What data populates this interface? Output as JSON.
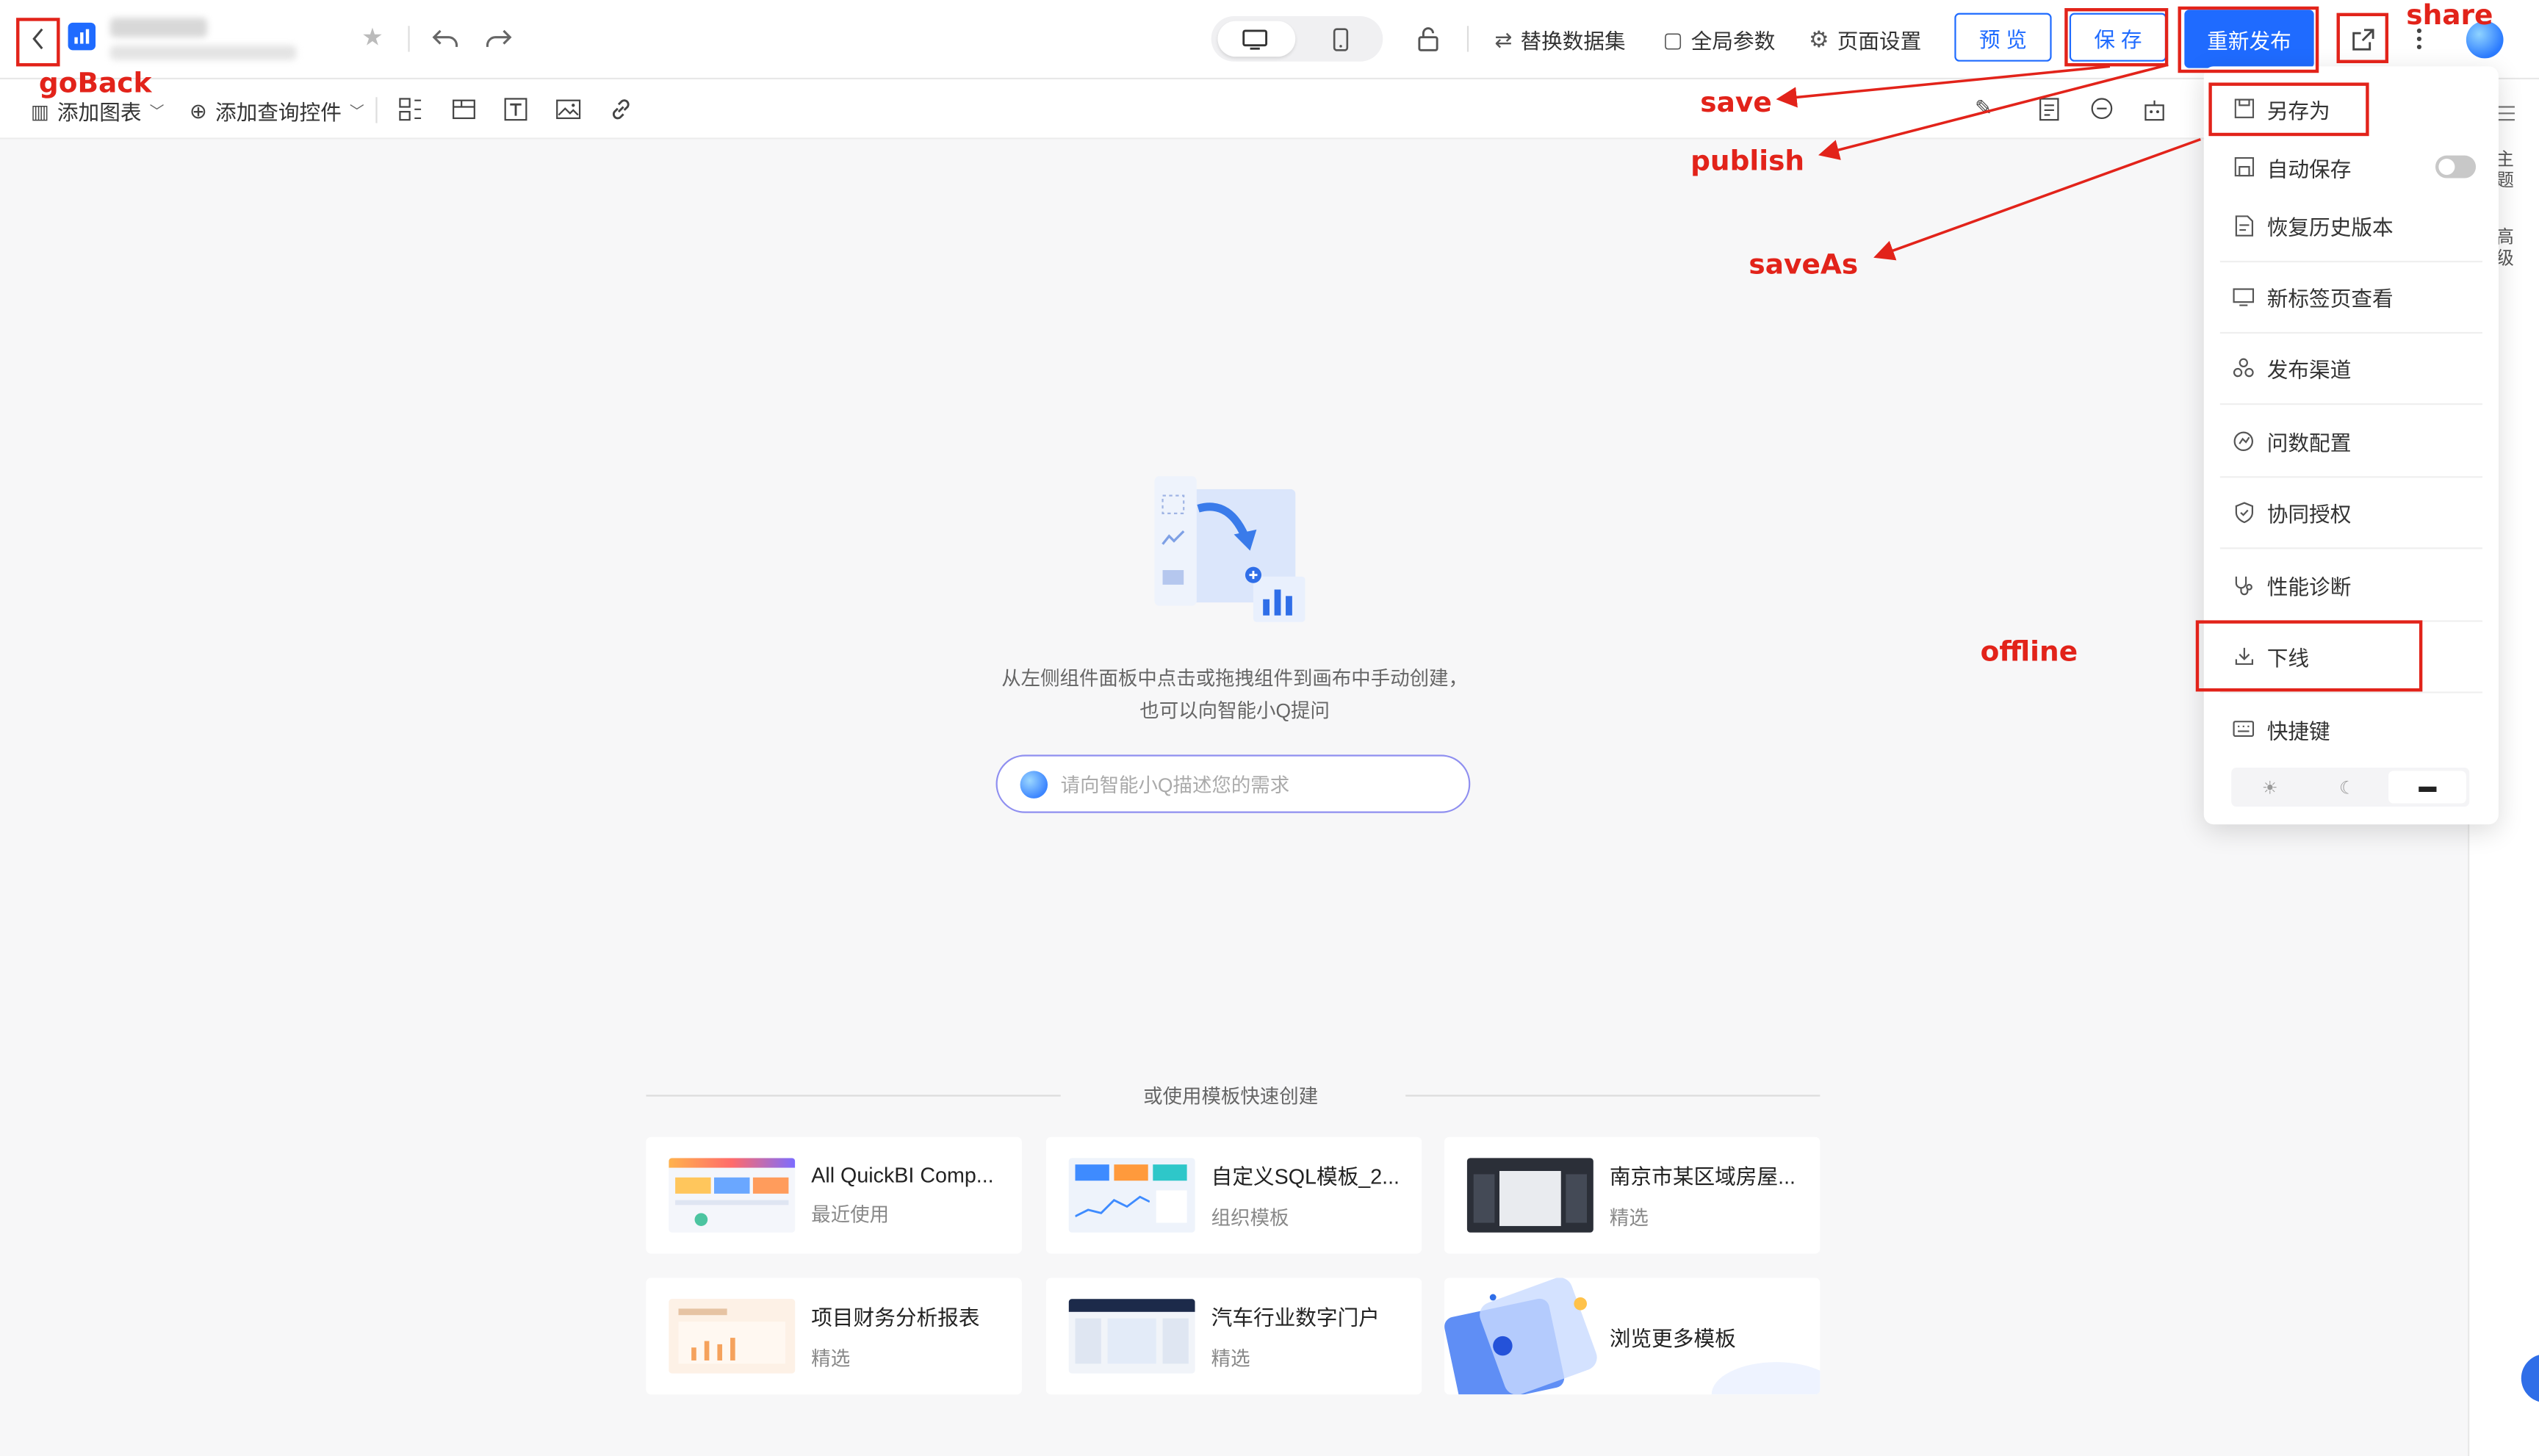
{
  "header": {
    "toolbar_labels": {
      "replace_dataset": "替换数据集",
      "global_params": "全局参数",
      "page_settings": "页面设置"
    },
    "buttons": {
      "preview": "预 览",
      "save": "保 存",
      "republish": "重新发布"
    }
  },
  "toolbar2": {
    "add_chart": "添加图表",
    "add_query_control": "添加查询控件"
  },
  "canvas": {
    "empty_line1": "从左侧组件面板中点击或拖拽组件到画布中手动创建，",
    "empty_line2": "也可以向智能小Q提问",
    "q_placeholder": "请向智能小Q描述您的需求",
    "template_heading": "或使用模板快速创建",
    "templates": [
      {
        "name": "All QuickBI Comp...",
        "sub": "最近使用"
      },
      {
        "name": "自定义SQL模板_2...",
        "sub": "组织模板"
      },
      {
        "name": "南京市某区域房屋...",
        "sub": "精选"
      },
      {
        "name": "项目财务分析报表",
        "sub": "精选"
      },
      {
        "name": "汽车行业数字门户",
        "sub": "精选"
      },
      {
        "name": "浏览更多模板",
        "sub": ""
      }
    ]
  },
  "menu": {
    "items": [
      {
        "label": "另存为"
      },
      {
        "label": "自动保存"
      },
      {
        "label": "恢复历史版本"
      },
      {
        "label": "新标签页查看"
      },
      {
        "label": "发布渠道"
      },
      {
        "label": "问数配置"
      },
      {
        "label": "协同授权"
      },
      {
        "label": "性能诊断"
      },
      {
        "label": "下线"
      },
      {
        "label": "快捷键"
      }
    ]
  },
  "right_rail": {
    "theme": "主题",
    "advanced": "高级"
  },
  "annotations": {
    "goBack": "goBack",
    "save": "save",
    "publish": "publish",
    "saveAs": "saveAs",
    "offline": "offline",
    "share": "share"
  },
  "colors": {
    "primary": "#1f6bff",
    "annotation": "#e2231a"
  }
}
